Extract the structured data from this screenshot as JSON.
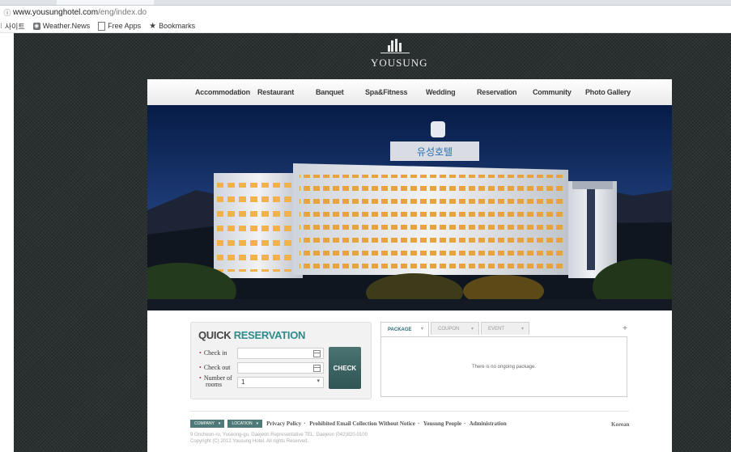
{
  "browser": {
    "url_host": "www.yousunghotel.com",
    "url_path": "/eng/index.do",
    "bookmarks": [
      {
        "label": "사이트",
        "icon": "apps-icon"
      },
      {
        "label": "Weather.News",
        "icon": "weather-icon"
      },
      {
        "label": "Free Apps",
        "icon": "document-icon"
      },
      {
        "label": "Bookmarks",
        "icon": "star-icon"
      }
    ]
  },
  "logo": {
    "word": "YOUSUNG"
  },
  "nav": {
    "items": [
      "Accommodation",
      "Restaurant",
      "Banquet",
      "Spa&Fitness",
      "Wedding",
      "Reservation",
      "Community",
      "Photo Gallery"
    ]
  },
  "quick_reservation": {
    "title_a": "QUICK ",
    "title_b": "RESERVATION",
    "checkin_label": "Check in",
    "checkout_label": "Check out",
    "rooms_label_1": "Number of",
    "rooms_label_2": "rooms",
    "rooms_value": "1",
    "check_button": "CHECK"
  },
  "packages": {
    "tabs": [
      "PACKAGE",
      "COUPON",
      "EVENT"
    ],
    "plus": "+",
    "message": "There is no ongoing package."
  },
  "footer": {
    "company": "COMPANY",
    "location": "LOCATION",
    "links": [
      "Privacy Policy",
      "Prohibited Email Collection Without Notice",
      "Yousung People",
      "Administration"
    ],
    "separator": "·",
    "language": "Korean",
    "address": "9 Oncheon-ro, Yuseong-gu, Daejeon Representative TEL. Daejeon (042)820-0100",
    "copyright": "Copyright (C) 2012 Yousung Hotel. All rights Reserved."
  },
  "colors": {
    "accent_teal": "#2f8a8c",
    "button_teal": "#3e6665",
    "site_background": "#2b3131"
  }
}
